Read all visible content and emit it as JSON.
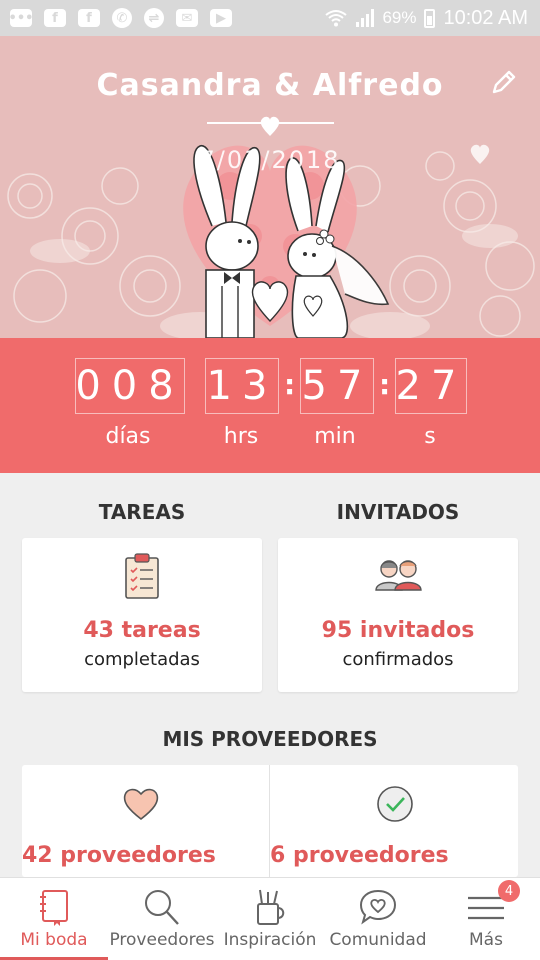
{
  "status_bar": {
    "battery": "69%",
    "time": "10:02 AM"
  },
  "hero": {
    "couple_name": "Casandra & Alfredo",
    "wedding_date": "7/03/2018"
  },
  "countdown": {
    "days": "008",
    "hours": "13",
    "minutes": "57",
    "seconds": "27",
    "days_label": "días",
    "hours_label": "hrs",
    "minutes_label": "min",
    "seconds_label": "s"
  },
  "tasks": {
    "heading": "TAREAS",
    "value": "43 tareas",
    "sub": "completadas"
  },
  "guests": {
    "heading": "INVITADOS",
    "value": "95 invitados",
    "sub": "confirmados"
  },
  "vendors": {
    "heading": "MIS PROVEEDORES",
    "favorites_value": "42 proveedores",
    "booked_value": "6 proveedores"
  },
  "bottom_nav": {
    "items": [
      {
        "label": "Mi boda",
        "icon": "notebook-icon"
      },
      {
        "label": "Proveedores",
        "icon": "search-icon"
      },
      {
        "label": "Inspiración",
        "icon": "inspiration-icon"
      },
      {
        "label": "Comunidad",
        "icon": "chat-heart-icon"
      },
      {
        "label": "Más",
        "icon": "menu-icon"
      }
    ],
    "more_badge": "4"
  },
  "colors": {
    "accent": "#f06b6b",
    "accent_text": "#e05a5a",
    "hero_bg": "#e7bdbb"
  }
}
